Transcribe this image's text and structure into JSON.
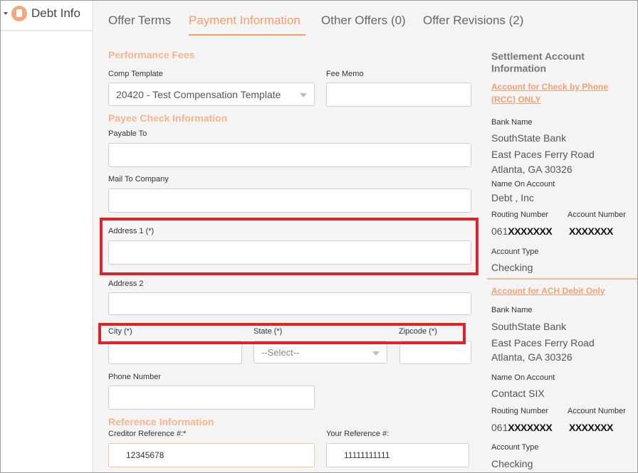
{
  "sidebar": {
    "debt_info_label": "Debt Info"
  },
  "tabs": [
    {
      "label": "Offer Terms"
    },
    {
      "label": "Payment Information"
    },
    {
      "label": "Other Offers (0)"
    },
    {
      "label": "Offer Revisions (2)"
    }
  ],
  "performance_fees": {
    "title": "Performance Fees",
    "comp_template_label": "Comp Template",
    "comp_template_value": "20420 - Test Compensation Template",
    "fee_memo_label": "Fee Memo",
    "fee_memo_value": ""
  },
  "payee_check": {
    "title": "Payee Check Information",
    "payable_to_label": "Payable To",
    "mail_to_company_label": "Mail To Company",
    "address1_label": "Address 1  (*)",
    "address2_label": "Address 2",
    "city_label": "City  (*)",
    "state_label": "State  (*)",
    "state_value": "--Select--",
    "zipcode_label": "Zipcode  (*)",
    "phone_label": "Phone Number"
  },
  "reference": {
    "title": "Reference Information",
    "creditor_ref_label": "Creditor Reference #:*",
    "creditor_ref_value": "12345678",
    "your_ref_label": "Your Reference #:",
    "your_ref_value": "11111111111"
  },
  "settlement": {
    "heading": "Settlement Account Information",
    "rcc": {
      "link": "Account for Check by Phone (RCC) ONLY",
      "bank_name_label": "Bank Name",
      "bank_name": "SouthState Bank",
      "address_line1": "East Paces Ferry Road",
      "address_line2": "Atlanta, GA 30326",
      "name_on_account_label": "Name On Account",
      "name_on_account": "Debt , Inc",
      "routing_label": "Routing Number",
      "routing_prefix": "061",
      "routing_masked": "XXXXXXX",
      "account_label": "Account Number",
      "account_masked": "XXXXXXX",
      "account_type_label": "Account Type",
      "account_type": "Checking"
    },
    "ach": {
      "link": "Account for ACH Debit Only",
      "bank_name_label": "Bank Name",
      "bank_name": "SouthState Bank",
      "address_line1": "East Paces Ferry Road",
      "address_line2": "Atlanta, GA 30326",
      "name_on_account_label": "Name On Account",
      "name_on_account": "Contact SIX",
      "routing_label": "Routing Number",
      "routing_prefix": "061",
      "routing_masked": "XXXXXXX",
      "account_label": "Account Number",
      "account_masked": "XXXXXXX",
      "account_type_label": "Account Type",
      "account_type": "Checking"
    }
  },
  "colors": {
    "accent": "#f39d6b",
    "section_title": "#f7b48e",
    "highlight_box": "#e0232b"
  }
}
